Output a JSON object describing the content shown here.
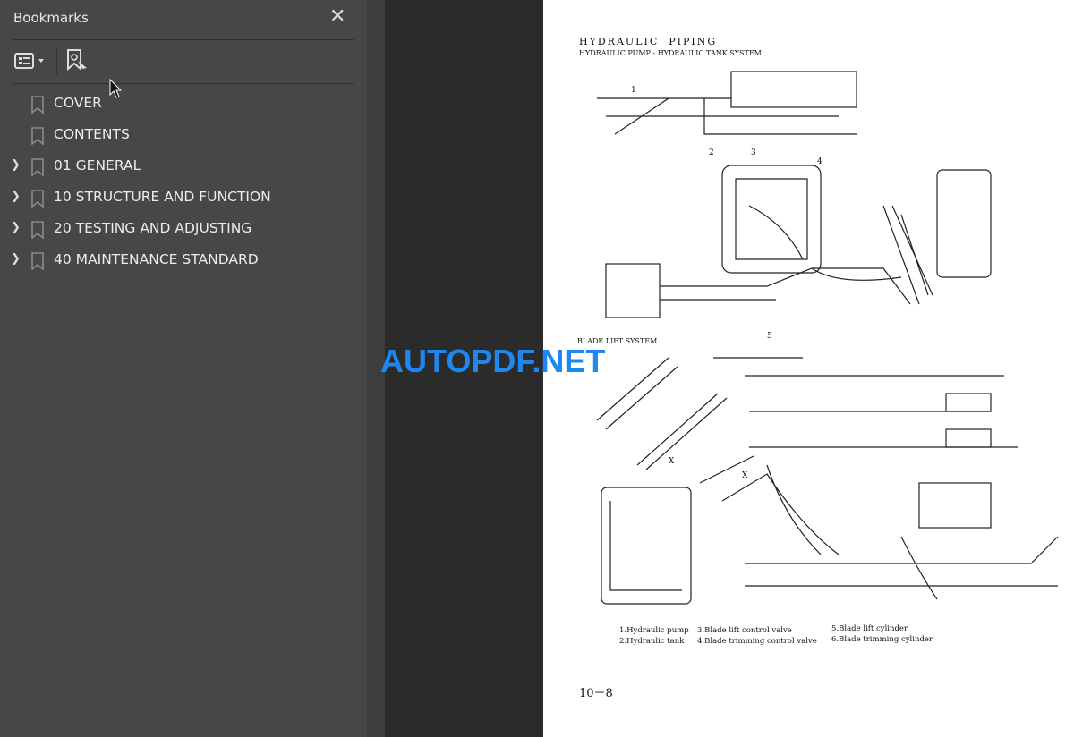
{
  "sidebar": {
    "title": "Bookmarks",
    "close_icon": "close-icon",
    "toolbar": {
      "options_icon": "list-options-icon",
      "find_icon": "find-bookmark-icon"
    },
    "items": [
      {
        "label": "COVER",
        "expandable": false
      },
      {
        "label": "CONTENTS",
        "expandable": false
      },
      {
        "label": "01 GENERAL",
        "expandable": true
      },
      {
        "label": "10 STRUCTURE AND FUNCTION",
        "expandable": true
      },
      {
        "label": "20 TESTING AND ADJUSTING",
        "expandable": true
      },
      {
        "label": "40 MAINTENANCE STANDARD",
        "expandable": true
      }
    ]
  },
  "page": {
    "heading": "HYDRAULIC  PIPING",
    "subheading": "HYDRAULIC PUMP - HYDRAULIC TANK SYSTEM",
    "section2": "BLADE LIFT SYSTEM",
    "callouts": [
      "1",
      "2",
      "3",
      "4",
      "5",
      "X",
      "X"
    ],
    "legend": [
      "1.Hydraulic pump",
      "2.Hydraulic tank",
      "3.Blade lift control valve",
      "4.Blade trimming control valve",
      "5.Blade lift cylinder",
      "6.Blade trimming cylinder"
    ],
    "page_number": "10－8"
  },
  "watermark": "AUTOPDF.NET"
}
